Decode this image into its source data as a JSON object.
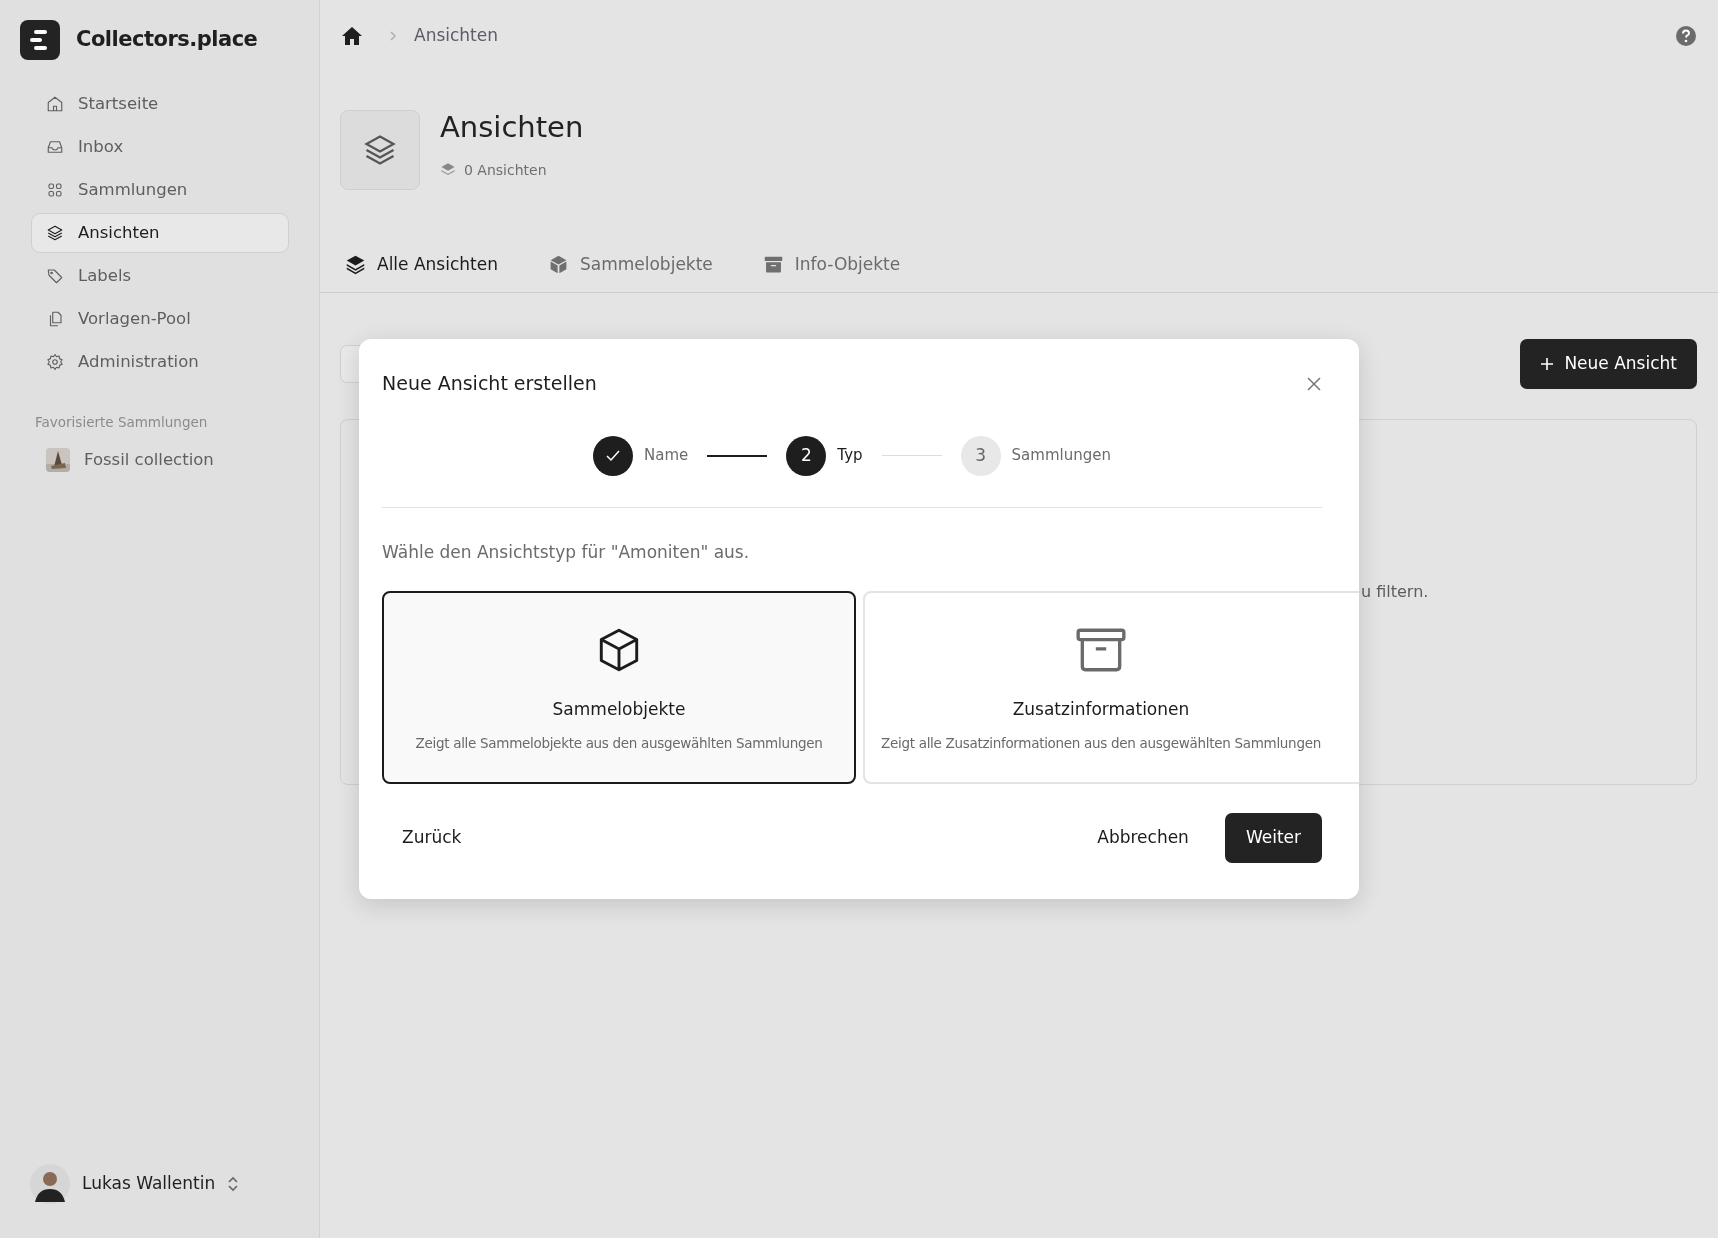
{
  "app": {
    "name": "Collectors.place"
  },
  "sidebar": {
    "items": [
      {
        "label": "Startseite",
        "selected": false
      },
      {
        "label": "Inbox",
        "selected": false
      },
      {
        "label": "Sammlungen",
        "selected": false
      },
      {
        "label": "Ansichten",
        "selected": true
      },
      {
        "label": "Labels",
        "selected": false
      },
      {
        "label": "Vorlagen-Pool",
        "selected": false
      },
      {
        "label": "Administration",
        "selected": false
      }
    ],
    "favorites_title": "Favorisierte Sammlungen",
    "favorites": [
      {
        "label": "Fossil collection",
        "kind": "picture"
      }
    ]
  },
  "user": {
    "name": "Lukas Wallentin"
  },
  "breadcrumb": [
    {
      "label": "Ansichten"
    }
  ],
  "page": {
    "title": "Ansichten",
    "count": "0 Ansichten"
  },
  "tabs": [
    {
      "label": "Alle Ansichten",
      "selected": true
    },
    {
      "label": "Sammelobjekte",
      "selected": false
    },
    {
      "label": "Info-Objekte",
      "selected": false
    }
  ],
  "new_button": "Neue Ansicht",
  "background_hint": "u filtern.",
  "dialog": {
    "title": "Neue Ansicht erstellen",
    "steps": [
      {
        "label": "Name",
        "done": true,
        "current": false
      },
      {
        "number": "2",
        "label": "Typ",
        "done": false,
        "current": true
      },
      {
        "number": "3",
        "label": "Sammlungen",
        "done": false,
        "current": false
      }
    ],
    "prompt": "Wähle den Ansichtstyp für \"Amoniten\" aus.",
    "options": [
      {
        "title": "Sammelobjekte",
        "description": "Zeigt alle Sammelobjekte aus den ausgewählten Sammlungen",
        "selected": true
      },
      {
        "title": "Zusatzinformationen",
        "description": "Zeigt alle Zusatzinformationen aus den ausgewählten Sammlungen",
        "selected": false
      }
    ],
    "back": "Zurück",
    "cancel": "Abbrechen",
    "next": "Weiter"
  }
}
